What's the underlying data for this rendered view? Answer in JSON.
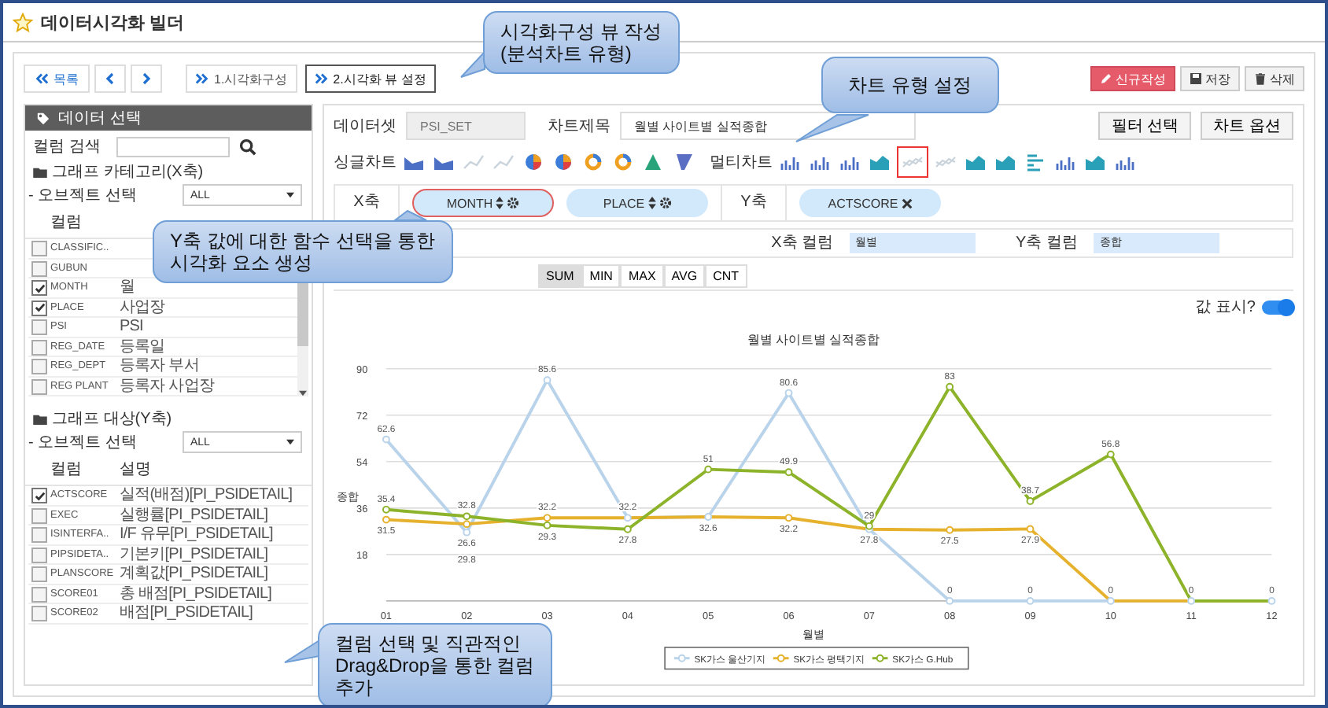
{
  "header": {
    "title": "데이터시각화 빌더"
  },
  "toolbar": {
    "list_button": "목록",
    "steps": [
      {
        "label": "1.시각화구성",
        "selected": false
      },
      {
        "label": "2.시각화 뷰 설정",
        "selected": true
      }
    ],
    "actions": [
      {
        "label": "신규작성",
        "kind": "new"
      },
      {
        "label": "저장",
        "kind": "save"
      },
      {
        "label": "삭제",
        "kind": "delete"
      }
    ]
  },
  "left_panel": {
    "title": "데이터 선택",
    "search_label": "컬럼 검색",
    "sections": [
      {
        "title": "그래프 카테고리(X축)",
        "object_label": "- 오브젝트 선택",
        "select": "ALL",
        "columns": [
          "컬럼"
        ],
        "rows": [
          {
            "name": "CLASSIFIC..",
            "checked": false
          },
          {
            "name": "GUBUN",
            "checked": false
          },
          {
            "name": "MONTH",
            "desc": "월",
            "checked": true
          },
          {
            "name": "PLACE",
            "desc": "사업장",
            "checked": true
          },
          {
            "name": "PSI",
            "desc": "PSI",
            "checked": false
          },
          {
            "name": "REG_DATE",
            "desc": "등록일",
            "checked": false
          },
          {
            "name": "REG_DEPT",
            "desc": "등록자 부서",
            "checked": false
          },
          {
            "name": "REG PLANT",
            "desc": "등록자 사업장",
            "checked": false
          }
        ]
      },
      {
        "title": "그래프 대상(Y축)",
        "object_label": "- 오브젝트 선택",
        "select": "ALL",
        "columns": [
          "컬럼",
          "설명"
        ],
        "rows": [
          {
            "name": "ACTSCORE",
            "desc": "실적(배점)[PI_PSIDETAIL]",
            "checked": true
          },
          {
            "name": "EXEC",
            "desc": "실행률[PI_PSIDETAIL]",
            "checked": false
          },
          {
            "name": "ISINTERFA..",
            "desc": "I/F 유무[PI_PSIDETAIL]",
            "checked": false
          },
          {
            "name": "PIPSIDETA..",
            "desc": "기본키[PI_PSIDETAIL]",
            "checked": false
          },
          {
            "name": "PLANSCORE",
            "desc": "계획값[PI_PSIDETAIL]",
            "checked": false
          },
          {
            "name": "SCORE01",
            "desc": "총 배점[PI_PSIDETAIL]",
            "checked": false
          },
          {
            "name": "SCORE02",
            "desc": "배점[PI_PSIDETAIL]",
            "checked": false
          }
        ]
      }
    ]
  },
  "main_panel": {
    "dataset_label": "데이터셋",
    "dataset": "PSI_SET",
    "title_label": "차트제목",
    "chart_title": "월별 사이트별 실적종합",
    "buttons": [
      "필터 선택",
      "차트 옵션"
    ],
    "single_label": "싱글차트",
    "single_charts": [
      {
        "kind": "area",
        "selected": false
      },
      {
        "kind": "area",
        "selected": false
      },
      {
        "kind": "line",
        "selected": false
      },
      {
        "kind": "line",
        "selected": false
      },
      {
        "kind": "pie",
        "selected": false
      },
      {
        "kind": "pie",
        "selected": false
      },
      {
        "kind": "donut",
        "selected": false
      },
      {
        "kind": "donut",
        "selected": false
      },
      {
        "kind": "pyramid",
        "selected": false
      },
      {
        "kind": "funnel",
        "selected": false
      }
    ],
    "multi_label": "멀티차트",
    "multi_charts": [
      {
        "kind": "column",
        "selected": false
      },
      {
        "kind": "column",
        "selected": false
      },
      {
        "kind": "column",
        "selected": false
      },
      {
        "kind": "area",
        "selected": false
      },
      {
        "kind": "line",
        "selected": true
      },
      {
        "kind": "line",
        "selected": false
      },
      {
        "kind": "area",
        "selected": false
      },
      {
        "kind": "area",
        "selected": false
      },
      {
        "kind": "bar",
        "selected": false
      },
      {
        "kind": "column",
        "selected": false
      },
      {
        "kind": "area",
        "selected": false
      },
      {
        "kind": "column",
        "selected": false
      }
    ],
    "x_axis_label": "X축",
    "x_pills": [
      {
        "label": "MONTH",
        "selected": true
      },
      {
        "label": "PLACE",
        "selected": false
      }
    ],
    "y_axis_label": "Y축",
    "y_pills": [
      {
        "label": "ACTSCORE"
      }
    ],
    "x_column_label": "X축 컬럼",
    "x_column": "월별",
    "y_column_label": "Y축 컬럼",
    "y_column": "종합",
    "functions": [
      {
        "label": "SUM",
        "selected": true
      },
      {
        "label": "MIN",
        "selected": false
      },
      {
        "label": "MAX",
        "selected": false
      },
      {
        "label": "AVG",
        "selected": false
      },
      {
        "label": "CNT",
        "selected": false
      }
    ],
    "show_values_label": "값 표시?",
    "show_values": true,
    "chart_data": {
      "type": "line",
      "title": "월별 사이트별 실적종합",
      "xlabel": "월별",
      "ylabel": "종합",
      "categories": [
        "01",
        "02",
        "03",
        "04",
        "05",
        "06",
        "07",
        "08",
        "09",
        "10",
        "11",
        "12"
      ],
      "series": [
        {
          "name": "SK가스 울산기지",
          "color": "#b9d3ea",
          "marker": "circle",
          "values": [
            62.6,
            26.6,
            85.6,
            32.2,
            32.6,
            80.6,
            27.8,
            0,
            0,
            0,
            0,
            0
          ],
          "value_labels": [
            "62.6",
            "26.6",
            "85.6",
            "32.2",
            null,
            "80.6",
            null,
            "0",
            "0",
            "0",
            null,
            null
          ]
        },
        {
          "name": "SK가스 평택기지",
          "color": "#e6b12d",
          "marker": "circle",
          "values": [
            31.5,
            29.8,
            32.2,
            32.2,
            32.6,
            32.2,
            27.8,
            27.5,
            27.9,
            0,
            0,
            0
          ],
          "value_labels": [
            "31.5",
            "29.8",
            "32.2",
            null,
            "32.6",
            "32.2",
            "27.8",
            "27.5",
            "27.9",
            null,
            null,
            null
          ]
        },
        {
          "name": "SK가스 G.Hub",
          "color": "#8db32a",
          "marker": "circle",
          "values": [
            35.4,
            32.8,
            29.3,
            27.8,
            51,
            49.9,
            29,
            83,
            38.7,
            56.8,
            0,
            0
          ],
          "value_labels": [
            "35.4",
            "32.8",
            "29.3",
            "27.8",
            "51",
            "49.9",
            "29",
            "83",
            "38.7",
            "56.8",
            "0",
            "0"
          ]
        }
      ],
      "ylim": [
        0,
        90
      ],
      "yticks": [
        18,
        36,
        54,
        72,
        90
      ],
      "grid": true,
      "legend": "bottom"
    }
  },
  "callouts": [
    {
      "text": "시각화구성 뷰 작성\n(분석차트 유형)"
    },
    {
      "text": "차트 유형 설정"
    },
    {
      "text": "Y축 값에 대한 함수 선택을 통한\n시각화 요소 생성"
    },
    {
      "text": "컬럼 선택 및 직관적인\nDrag&Drop을 통한 컬럼\n추가"
    }
  ]
}
